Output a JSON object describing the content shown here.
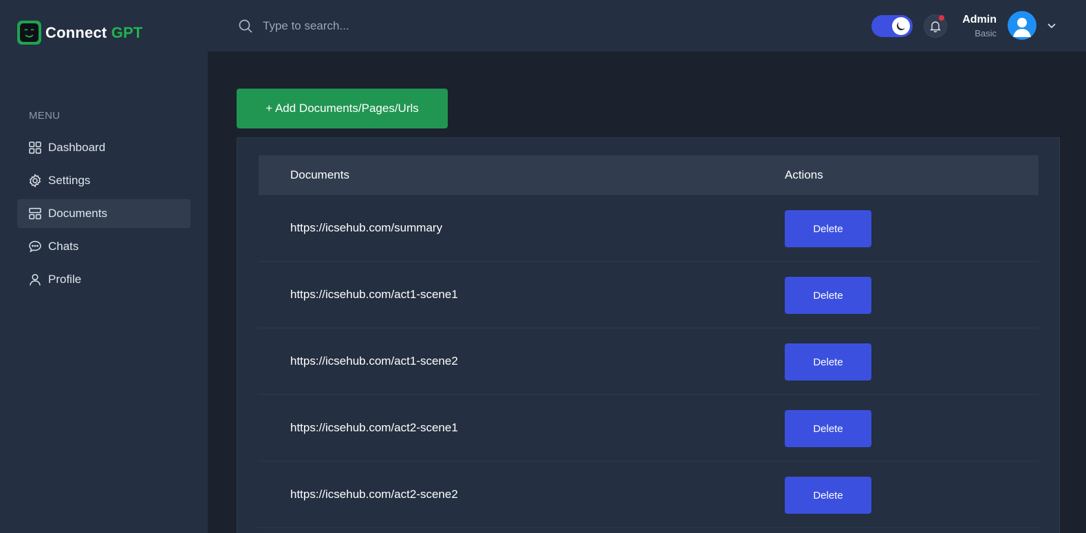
{
  "brand": {
    "word1": "Connect",
    "word2": "GPT",
    "accent": "#22b350"
  },
  "sidebar": {
    "menu_title": "MENU",
    "items": [
      {
        "label": "Dashboard",
        "icon": "grid-icon",
        "active": false
      },
      {
        "label": "Settings",
        "icon": "gear-icon",
        "active": false
      },
      {
        "label": "Documents",
        "icon": "layout-icon",
        "active": true
      },
      {
        "label": "Chats",
        "icon": "chat-bubble-icon",
        "active": false
      },
      {
        "label": "Profile",
        "icon": "user-icon",
        "active": false
      }
    ]
  },
  "header": {
    "search_placeholder": "Type to search...",
    "theme_toggle": "dark",
    "notifications_unread": true,
    "user": {
      "name": "Admin",
      "role": "Basic"
    }
  },
  "main": {
    "add_button_label": "+ Add Documents/Pages/Urls",
    "table": {
      "columns": [
        "Documents",
        "Actions"
      ],
      "rows": [
        {
          "url": "https://icsehub.com/summary",
          "action": "Delete"
        },
        {
          "url": "https://icsehub.com/act1-scene1",
          "action": "Delete"
        },
        {
          "url": "https://icsehub.com/act1-scene2",
          "action": "Delete"
        },
        {
          "url": "https://icsehub.com/act2-scene1",
          "action": "Delete"
        },
        {
          "url": "https://icsehub.com/act2-scene2",
          "action": "Delete"
        }
      ]
    }
  },
  "colors": {
    "sidebar_bg": "#242f41",
    "page_bg": "#1b222d",
    "primary": "#3c50e0",
    "success": "#219653"
  }
}
